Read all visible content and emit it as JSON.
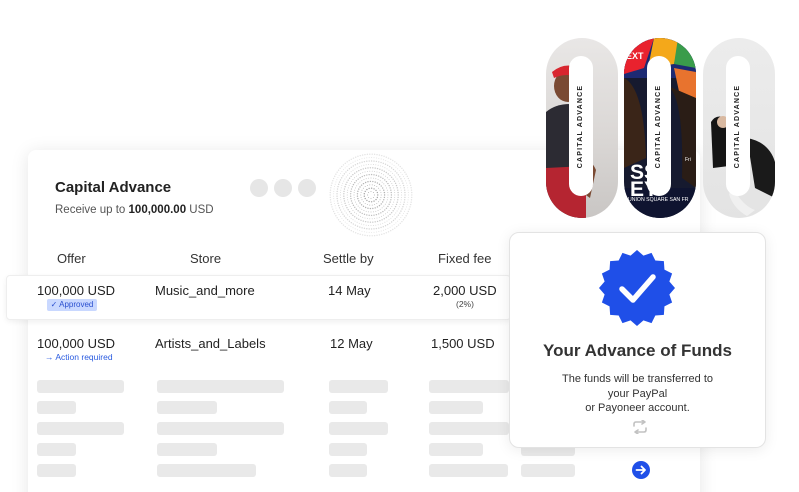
{
  "header": {
    "title": "Capital Advance",
    "subtitle_prefix": "Receive up to",
    "subtitle_amount": "100,000.00",
    "subtitle_suffix": "USD"
  },
  "table": {
    "columns": [
      "Offer",
      "Store",
      "Settle by",
      "Fixed fee"
    ],
    "rows": [
      {
        "offer": "100,000 USD",
        "status": "✓ Approved",
        "store": "Music_and_more",
        "settle_by": "14 May",
        "fee": "2,000 USD",
        "fee_pct": "(2%)"
      },
      {
        "offer": "100,000 USD",
        "status": "→ Action required",
        "store": "Artists_and_Labels",
        "settle_by": "12 May",
        "fee": "1,500 USD",
        "fee_pct": ""
      }
    ]
  },
  "promo_pills": [
    {
      "label": "CAPITAL ADVANCE",
      "photo_text": ""
    },
    {
      "label": "CAPITAL ADVANCE",
      "photo_text_top": "EXT",
      "photo_text_big": "SS EY",
      "photo_text_small": "Fri",
      "photo_text_bottom": "UNION SQUARE SAN FR"
    },
    {
      "label": "CAPITAL ADVANCE",
      "photo_text": ""
    }
  ],
  "funds_card": {
    "title": "Your Advance of Funds",
    "line1": "The funds will be transferred to",
    "line2": "your PayPal",
    "line3": "or Payoneer account."
  },
  "icons": {
    "verified": "verified-badge-icon",
    "repeat": "repeat-icon",
    "next": "arrow-right-circle-icon"
  },
  "colors": {
    "accent": "#1f4fe8",
    "badge_bg": "#c9d8ff",
    "skeleton": "#e9e9e9"
  }
}
